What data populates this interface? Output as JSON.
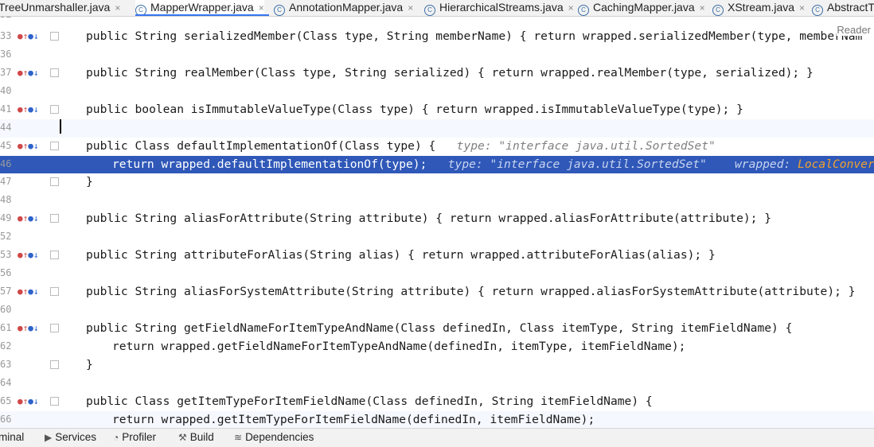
{
  "tabs": [
    {
      "label": "TreeUnmarshaller.java",
      "icon": "class-icon"
    },
    {
      "label": "MapperWrapper.java",
      "icon": "class-icon",
      "active": true
    },
    {
      "label": "AnnotationMapper.java",
      "icon": "class-icon"
    },
    {
      "label": "HierarchicalStreams.java",
      "icon": "class-icon"
    },
    {
      "label": "CachingMapper.java",
      "icon": "class-icon"
    },
    {
      "label": "XStream.java",
      "icon": "class-icon"
    },
    {
      "label": "AbstractTr",
      "icon": "class-icon"
    }
  ],
  "editor": {
    "reader_label": "Reader",
    "lines": [
      {
        "num": "32",
        "text": ""
      },
      {
        "num": "33",
        "text": "public String serializedMember(Class type, String memberName) { return wrapped.serializedMember(type, memberNam"
      },
      {
        "num": "36",
        "text": ""
      },
      {
        "num": "37",
        "text": "public String realMember(Class type, String serialized) { return wrapped.realMember(type, serialized); }"
      },
      {
        "num": "40",
        "text": ""
      },
      {
        "num": "41",
        "text": "public boolean isImmutableValueType(Class type) { return wrapped.isImmutableValueType(type); }"
      },
      {
        "num": "44",
        "text": ""
      },
      {
        "num": "45",
        "text": "public Class defaultImplementationOf(Class type) {",
        "hint": "type: \"interface java.util.SortedSet\""
      },
      {
        "num": "46",
        "text": "return wrapped.defaultImplementationOf(type);",
        "hint": "type: \"interface java.util.SortedSet\"",
        "hint2": "wrapped: ",
        "hint3": "LocalConversionMapp"
      },
      {
        "num": "47",
        "text": "}"
      },
      {
        "num": "48",
        "text": ""
      },
      {
        "num": "49",
        "text": "public String aliasForAttribute(String attribute) { return wrapped.aliasForAttribute(attribute); }"
      },
      {
        "num": "52",
        "text": ""
      },
      {
        "num": "53",
        "text": "public String attributeForAlias(String alias) { return wrapped.attributeForAlias(alias); }"
      },
      {
        "num": "56",
        "text": ""
      },
      {
        "num": "57",
        "text": "public String aliasForSystemAttribute(String attribute) { return wrapped.aliasForSystemAttribute(attribute); }"
      },
      {
        "num": "60",
        "text": ""
      },
      {
        "num": "61",
        "text": "public String getFieldNameForItemTypeAndName(Class definedIn, Class itemType, String itemFieldName) {"
      },
      {
        "num": "62",
        "text": "return wrapped.getFieldNameForItemTypeAndName(definedIn, itemType, itemFieldName);"
      },
      {
        "num": "63",
        "text": "}"
      },
      {
        "num": "64",
        "text": ""
      },
      {
        "num": "65",
        "text": "public Class getItemTypeForItemFieldName(Class definedIn, String itemFieldName) {"
      },
      {
        "num": "66",
        "text": "return wrapped.getItemTypeForItemFieldName(definedIn, itemFieldName);"
      }
    ]
  },
  "bottom_tools": [
    {
      "label": "minal",
      "icon": ""
    },
    {
      "label": "Services",
      "icon": "services-icon"
    },
    {
      "label": "Profiler",
      "icon": "profiler-icon"
    },
    {
      "label": "Build",
      "icon": "build-icon"
    },
    {
      "label": "Dependencies",
      "icon": "dependencies-icon"
    }
  ]
}
